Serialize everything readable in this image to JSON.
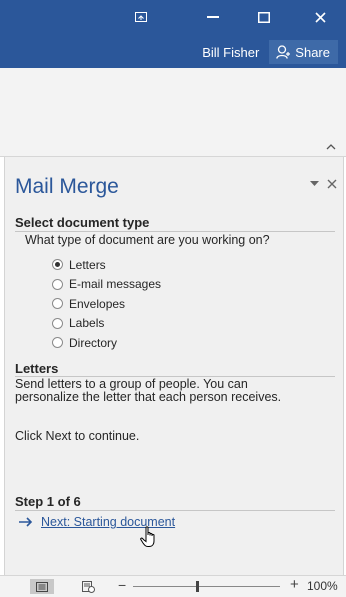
{
  "titlebar": {
    "user_name": "Bill Fisher",
    "share_label": "Share"
  },
  "pane": {
    "title": "Mail Merge",
    "select_heading": "Select document type",
    "question": "What type of document are you working on?",
    "options": [
      {
        "label": "Letters",
        "checked": true
      },
      {
        "label": "E-mail messages",
        "checked": false
      },
      {
        "label": "Envelopes",
        "checked": false
      },
      {
        "label": "Labels",
        "checked": false
      },
      {
        "label": "Directory",
        "checked": false
      }
    ],
    "letters_heading": "Letters",
    "description": "Send letters to a group of people. You can personalize the letter that each person receives.",
    "continue_text": "Click Next to continue.",
    "step_label": "Step 1 of 6",
    "next_link": "Next: Starting document"
  },
  "statusbar": {
    "zoom_minus": "−",
    "zoom_plus": "+",
    "zoom_level": "100%",
    "zoom_percent": 100
  },
  "colors": {
    "title_bar": "#2b579a",
    "accent": "#2b579a",
    "pane_bg": "#f0f0f0"
  },
  "icons": {
    "ribbon_display": "ribbon-display-options-icon",
    "minimize": "minimize-icon",
    "maximize": "maximize-icon",
    "close": "close-icon",
    "share": "share-person-icon",
    "collapse": "chevron-up-icon",
    "pane_options": "dropdown-triangle-icon",
    "pane_close": "close-icon",
    "next": "arrow-right-icon",
    "cursor": "hand-pointer-icon",
    "print_layout": "print-layout-icon",
    "web_layout": "web-layout-icon"
  }
}
